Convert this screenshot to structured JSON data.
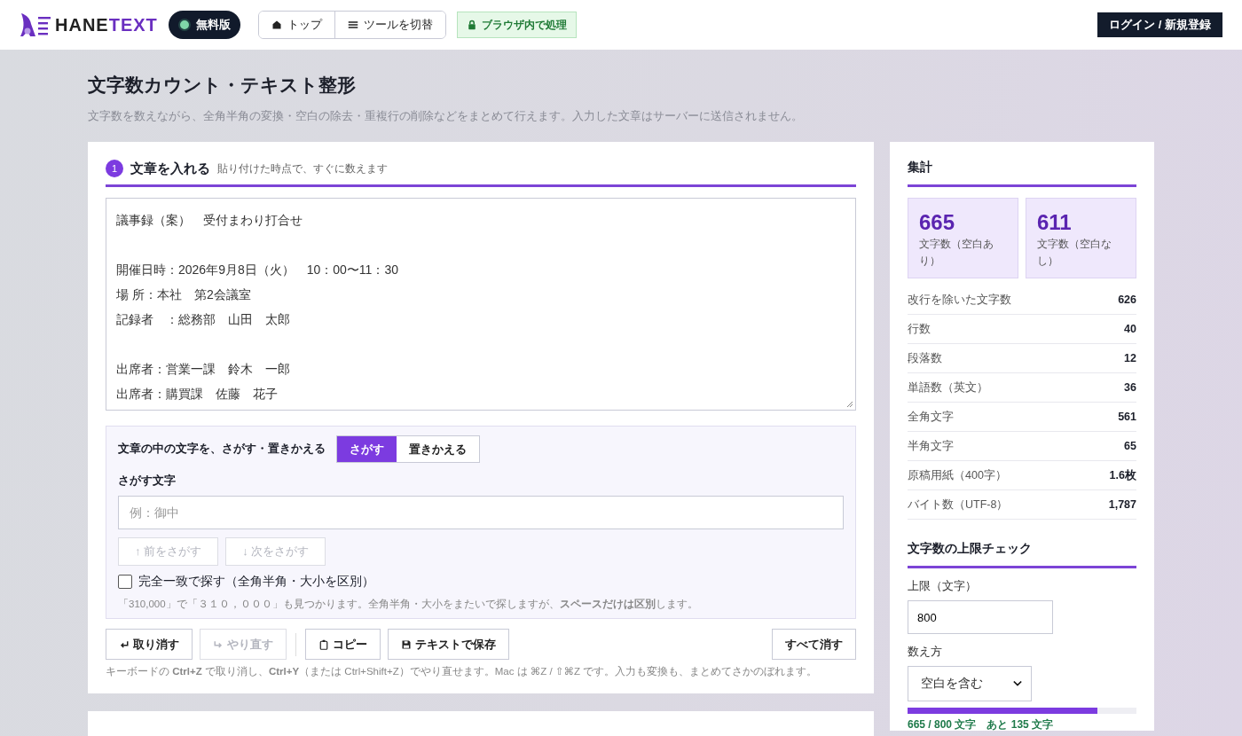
{
  "header": {
    "brand": {
      "part_1": "HANE",
      "part_2": "TEXT"
    },
    "plan_badge": "無料版",
    "nav": [
      {
        "label": "トップ",
        "kind": "home"
      },
      {
        "label": "ツールを切替",
        "kind": "menu"
      }
    ],
    "privacy_badge": "ブラウザ内で処理",
    "login_button": "ログイン / 新規登録"
  },
  "page": {
    "title": "文字数カウント・テキスト整形",
    "description": "文字数を数えながら、全角半角の変換・空白の除去・重複行の削除などをまとめて行えます。入力した文章はサーバーに送信されません。"
  },
  "input_section": {
    "step": "1",
    "title": "文章を入れる",
    "subtitle": "貼り付けた時点で、すぐに数えます",
    "paragraphs": [
      [
        "議事録（案）　受付まわり打合せ"
      ],
      [
        "開催日時：2026年9月8日（火）　10：00〜11：30",
        "場 所：本社　第2会議室",
        "記録者　：総務部　山田　太郎"
      ],
      [
        "出席者：営業一課　鈴木　一郎",
        "出席者：購買課　佐藤　花子"
      ]
    ]
  },
  "find_panel": {
    "label": "文章の中の文字を、さがす・置きかえる",
    "modes": [
      {
        "label": "さがす",
        "selected": true
      },
      {
        "label": "置きかえる",
        "selected": false
      }
    ],
    "field_label": "さがす文字",
    "placeholder": "例：御中",
    "nav_buttons": [
      {
        "label": "↑ 前をさがす",
        "disabled": true
      },
      {
        "label": "↓ 次をさがす",
        "disabled": true
      }
    ],
    "exact_match": {
      "label": "完全一致で探す（全角半角・大小を区別）",
      "checked": false
    },
    "hint": "「310,000」で「３１０，０００」も見つかります。全角半角・大小をまたいで探しますが、**スペースだけは区別**します。"
  },
  "actions": [
    {
      "label": "取り消す",
      "kind": "undo",
      "disabled": false
    },
    {
      "label": "やり直す",
      "kind": "redo",
      "disabled": true
    },
    {
      "label": "コピー",
      "kind": "copy",
      "disabled": false
    },
    {
      "label": "テキストで保存",
      "kind": "save",
      "disabled": false
    },
    {
      "label": "すべて消す",
      "kind": "clear",
      "disabled": false
    }
  ],
  "keyboard_hint": "キーボードの **Ctrl+Z** で取り消し、**Ctrl+Y**（または Ctrl+Shift+Z）でやり直せます。Mac は ⌘Z / ⇧⌘Z です。入力も変換も、まとめてさかのぼれます。",
  "summary": {
    "title": "集計",
    "highlights": [
      {
        "value": "665",
        "label": "文字数（空白あり）"
      },
      {
        "value": "611",
        "label": "文字数（空白なし）"
      }
    ],
    "rows": [
      {
        "label": "改行を除いた文字数",
        "value": "626"
      },
      {
        "label": "行数",
        "value": "40"
      },
      {
        "label": "段落数",
        "value": "12"
      },
      {
        "label": "単語数（英文）",
        "value": "36"
      },
      {
        "label": "全角文字",
        "value": "561"
      },
      {
        "label": "半角文字",
        "value": "65"
      },
      {
        "label": "原稿用紙（400字）",
        "value": "1.6枚"
      },
      {
        "label": "バイト数（UTF-8）",
        "value": "1,787"
      }
    ]
  },
  "limit_check": {
    "title": "文字数の上限チェック",
    "limit_label": "上限（文字）",
    "limit_value": "800",
    "method_label": "数え方",
    "method_value": "空白を含む",
    "level": 0.83,
    "status": "665 / 800 文字　あと 135 文字"
  }
}
